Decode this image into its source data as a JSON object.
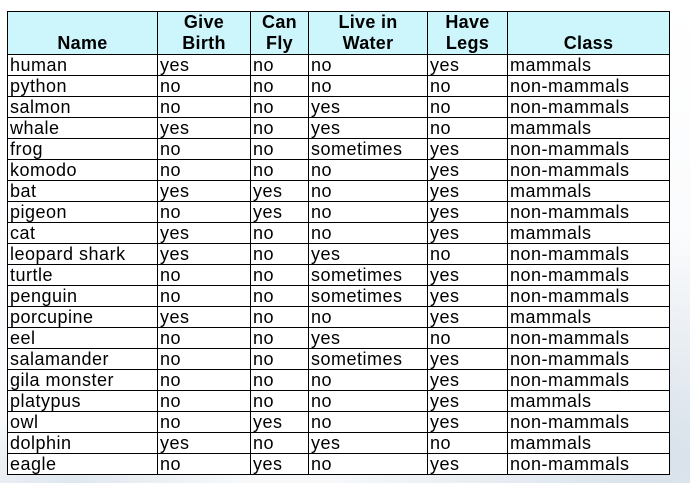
{
  "table": {
    "headers": [
      {
        "line1": "",
        "line2": "Name"
      },
      {
        "line1": "Give",
        "line2": "Birth"
      },
      {
        "line1": "Can",
        "line2": "Fly"
      },
      {
        "line1": "Live in",
        "line2": "Water"
      },
      {
        "line1": "Have",
        "line2": "Legs"
      },
      {
        "line1": "",
        "line2": "Class"
      }
    ],
    "rows": [
      [
        "human",
        "yes",
        "no",
        "no",
        "yes",
        "mammals"
      ],
      [
        "python",
        "no",
        "no",
        "no",
        "no",
        "non-mammals"
      ],
      [
        "salmon",
        "no",
        "no",
        "yes",
        "no",
        "non-mammals"
      ],
      [
        "whale",
        "yes",
        "no",
        "yes",
        "no",
        "mammals"
      ],
      [
        "frog",
        "no",
        "no",
        "sometimes",
        "yes",
        "non-mammals"
      ],
      [
        "komodo",
        "no",
        "no",
        "no",
        "yes",
        "non-mammals"
      ],
      [
        "bat",
        "yes",
        "yes",
        "no",
        "yes",
        "mammals"
      ],
      [
        "pigeon",
        "no",
        "yes",
        "no",
        "yes",
        "non-mammals"
      ],
      [
        "cat",
        "yes",
        "no",
        "no",
        "yes",
        "mammals"
      ],
      [
        "leopard shark",
        "yes",
        "no",
        "yes",
        "no",
        "non-mammals"
      ],
      [
        "turtle",
        "no",
        "no",
        "sometimes",
        "yes",
        "non-mammals"
      ],
      [
        "penguin",
        "no",
        "no",
        "sometimes",
        "yes",
        "non-mammals"
      ],
      [
        "porcupine",
        "yes",
        "no",
        "no",
        "yes",
        "mammals"
      ],
      [
        "eel",
        "no",
        "no",
        "yes",
        "no",
        "non-mammals"
      ],
      [
        "salamander",
        "no",
        "no",
        "sometimes",
        "yes",
        "non-mammals"
      ],
      [
        "gila monster",
        "no",
        "no",
        "no",
        "yes",
        "non-mammals"
      ],
      [
        "platypus",
        "no",
        "no",
        "no",
        "yes",
        "mammals"
      ],
      [
        "owl",
        "no",
        "yes",
        "no",
        "yes",
        "non-mammals"
      ],
      [
        "dolphin",
        "yes",
        "no",
        "yes",
        "no",
        "mammals"
      ],
      [
        "eagle",
        "no",
        "yes",
        "no",
        "yes",
        "non-mammals"
      ]
    ]
  },
  "colors": {
    "header_background": "#ccf6fb",
    "border": "#000000"
  }
}
